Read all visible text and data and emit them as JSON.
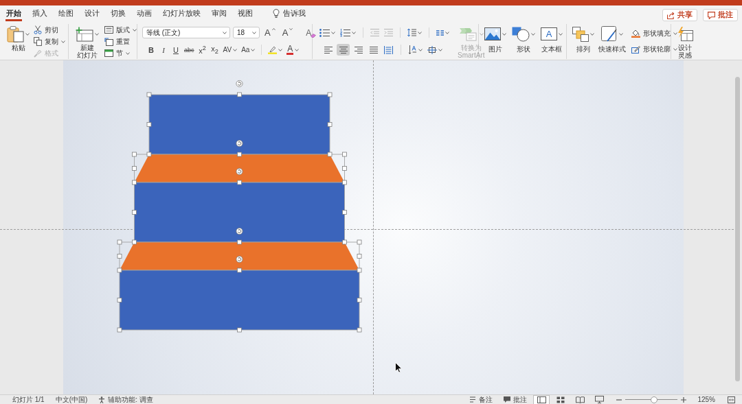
{
  "tabs": [
    {
      "label": "开始",
      "selected": true
    },
    {
      "label": "插入",
      "selected": false
    },
    {
      "label": "绘图",
      "selected": false
    },
    {
      "label": "设计",
      "selected": false
    },
    {
      "label": "切换",
      "selected": false
    },
    {
      "label": "动画",
      "selected": false
    },
    {
      "label": "幻灯片放映",
      "selected": false
    },
    {
      "label": "审阅",
      "selected": false
    },
    {
      "label": "视图",
      "selected": false
    }
  ],
  "tell_me": "告诉我",
  "header_buttons": [
    {
      "label": "共享",
      "kind": "share"
    },
    {
      "label": "批注",
      "kind": "comment"
    }
  ],
  "clipboard": {
    "paste": "粘贴",
    "small": [
      {
        "label": "剪切",
        "kind": "cut",
        "caret": false,
        "disabled": false
      },
      {
        "label": "复制",
        "kind": "copy",
        "caret": true,
        "disabled": false
      },
      {
        "label": "格式",
        "kind": "painter",
        "caret": false,
        "disabled": true
      }
    ]
  },
  "slides": {
    "new_slide": [
      "新建",
      "幻灯片"
    ],
    "small": [
      {
        "label": "版式",
        "kind": "layout",
        "caret": true
      },
      {
        "label": "重置",
        "kind": "reset",
        "caret": false
      },
      {
        "label": "节",
        "kind": "section",
        "caret": true
      }
    ]
  },
  "font": {
    "name": "等线 (正文)",
    "size": "18",
    "grow": "A",
    "shrink": "A",
    "clear": "A",
    "styles": [
      {
        "glyph": "B",
        "kind": "bold"
      },
      {
        "glyph": "I",
        "kind": "italic"
      },
      {
        "glyph": "U",
        "kind": "underline"
      },
      {
        "glyph": "abc",
        "kind": "strike"
      },
      {
        "glyph": "x$^{2}$",
        "kind": "superscript"
      },
      {
        "glyph": "x$_{2}$",
        "kind": "subscript"
      },
      {
        "glyph": "AV",
        "kind": "spacing"
      },
      {
        "glyph": "Aa",
        "kind": "case"
      }
    ],
    "color_glyph": "A"
  },
  "paragraph": {
    "alignments": [
      {
        "kind": "left",
        "selected": false
      },
      {
        "kind": "center",
        "selected": true
      },
      {
        "kind": "right",
        "selected": false
      },
      {
        "kind": "justify",
        "selected": false
      },
      {
        "kind": "distributed",
        "selected": false
      }
    ],
    "smartart": {
      "lines": [
        "转换为",
        "SmartArt"
      ],
      "disabled": true
    }
  },
  "insert": [
    {
      "label": "图片",
      "kind": "picture"
    },
    {
      "label": "形状",
      "kind": "shapes"
    },
    {
      "label": "文本框",
      "kind": "textbox",
      "glyph": "A"
    }
  ],
  "arrange": {
    "big": [
      {
        "label": "排列",
        "kind": "arrange"
      },
      {
        "label": "快速样式",
        "kind": "styles"
      }
    ],
    "small": [
      {
        "label": "形状填充",
        "kind": "fill",
        "caret": true
      },
      {
        "label": "形状轮廓",
        "kind": "outline",
        "caret": true
      }
    ]
  },
  "designer": [
    "设计",
    "灵感"
  ],
  "slide": {
    "shapes": [
      {
        "kind": "rectangle",
        "color": "#3b64bb",
        "selected": true
      },
      {
        "kind": "trapezoid",
        "color": "#e9722b",
        "selected": true
      },
      {
        "kind": "rectangle",
        "color": "#3b64bb",
        "selected": true
      },
      {
        "kind": "trapezoid",
        "color": "#e9722b",
        "selected": true
      },
      {
        "kind": "rectangle",
        "color": "#3b64bb",
        "selected": true
      }
    ]
  },
  "status_bar": {
    "slide_counter": "幻灯片 1/1",
    "language": "中文(中国)",
    "accessibility": "辅助功能: 调查",
    "notes": "备注",
    "comments": "批注",
    "views": [
      {
        "kind": "normal",
        "selected": true
      },
      {
        "kind": "sorter",
        "selected": false
      },
      {
        "kind": "reading",
        "selected": false
      },
      {
        "kind": "slideshow",
        "selected": false
      }
    ],
    "zoom": {
      "level": 0.55,
      "reading": "125%"
    }
  }
}
